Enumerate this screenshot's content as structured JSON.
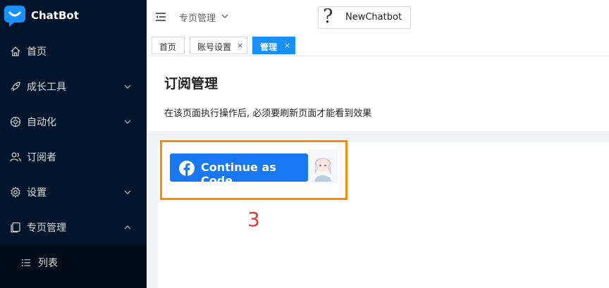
{
  "app": {
    "name": "ChatBot"
  },
  "sidebar": {
    "items": [
      {
        "label": "首页",
        "icon": "home-icon",
        "expandable": false
      },
      {
        "label": "成长工具",
        "icon": "rocket-icon",
        "expandable": true,
        "expanded": false
      },
      {
        "label": "自动化",
        "icon": "automation-icon",
        "expandable": true,
        "expanded": false
      },
      {
        "label": "订阅者",
        "icon": "users-icon",
        "expandable": false
      },
      {
        "label": "设置",
        "icon": "gear-icon",
        "expandable": true,
        "expanded": false
      },
      {
        "label": "专页管理",
        "icon": "pages-icon",
        "expandable": true,
        "expanded": true
      }
    ],
    "subitems": [
      {
        "label": "列表",
        "icon": "list-icon"
      }
    ]
  },
  "header": {
    "breadcrumb": "专页管理",
    "bot_name": "NewChatbot",
    "bot_avatar_glyph": "?"
  },
  "tabs": [
    {
      "label": "首页",
      "closable": false,
      "active": false
    },
    {
      "label": "账号设置",
      "closable": true,
      "active": false,
      "close": "×"
    },
    {
      "label": "管理",
      "closable": true,
      "active": true,
      "close": "×"
    }
  ],
  "main": {
    "title": "订阅管理",
    "description": "在该页面执行操作后, 必须要刷新页面才能看到效果",
    "fb_button_label": "Continue as Code",
    "annotation_number": "3"
  },
  "colors": {
    "sidebar_bg": "#001529",
    "accent": "#1890ff",
    "facebook_blue": "#1877f2",
    "highlight_orange": "#ff8c00",
    "annotation_red": "#e53935"
  }
}
